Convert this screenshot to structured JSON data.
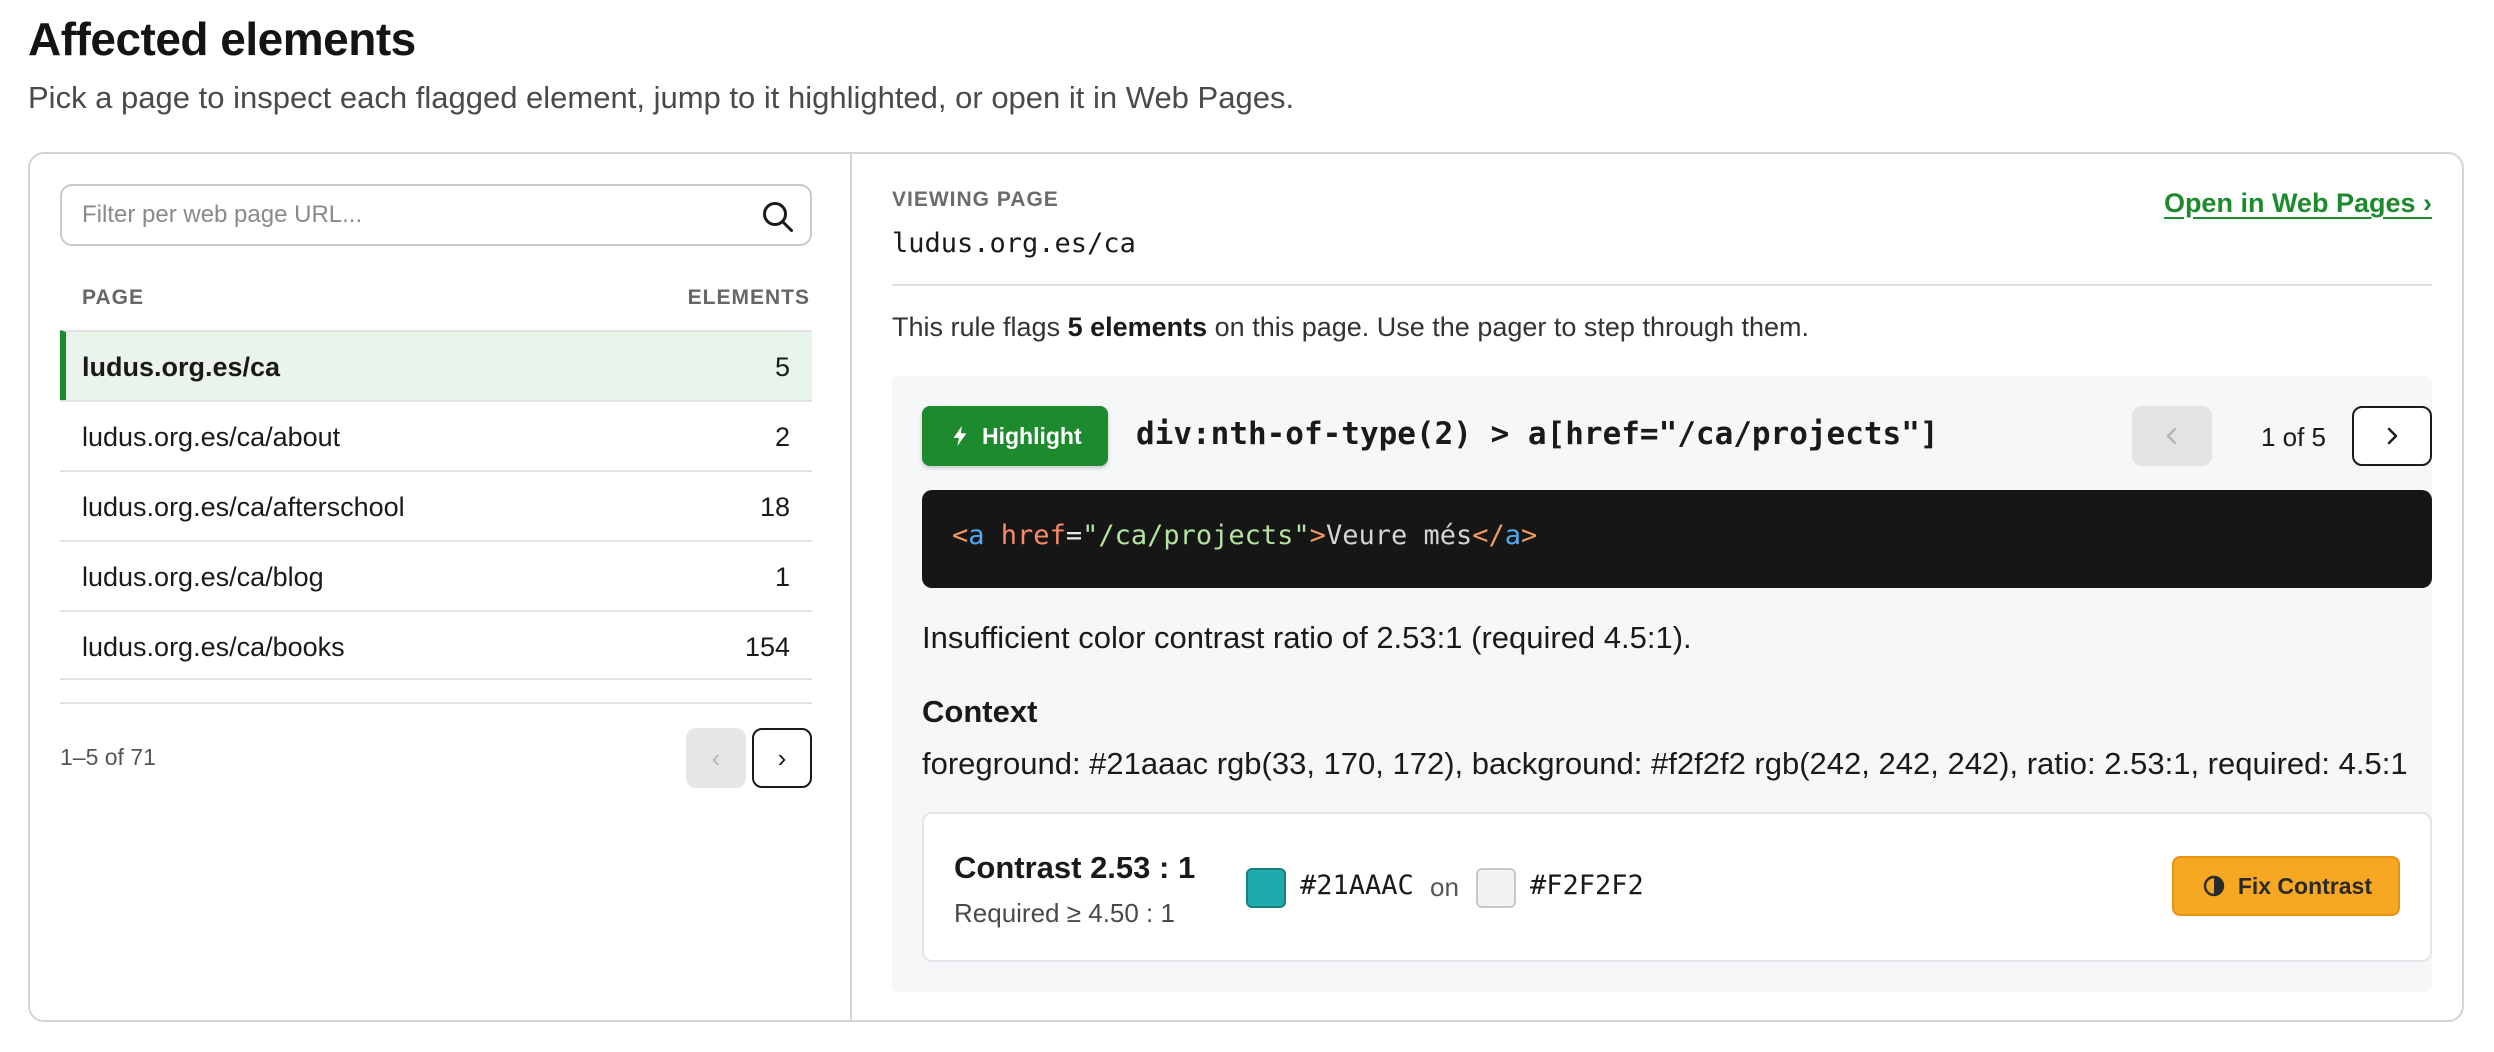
{
  "header": {
    "title": "Affected elements",
    "subtitle": "Pick a page to inspect each flagged element, jump to it highlighted, or open it in Web Pages."
  },
  "filter": {
    "placeholder": "Filter per web page URL...",
    "value": ""
  },
  "table": {
    "col_page": "PAGE",
    "col_elements": "ELEMENTS",
    "rows": [
      {
        "url": "ludus.org.es/ca",
        "count": "5",
        "selected": true
      },
      {
        "url": "ludus.org.es/ca/about",
        "count": "2",
        "selected": false
      },
      {
        "url": "ludus.org.es/ca/afterschool",
        "count": "18",
        "selected": false
      },
      {
        "url": "ludus.org.es/ca/blog",
        "count": "1",
        "selected": false
      },
      {
        "url": "ludus.org.es/ca/books",
        "count": "154",
        "selected": false
      }
    ],
    "range": "1–5 of 71",
    "prev": "‹",
    "next": "›"
  },
  "viewing": {
    "label": "VIEWING PAGE",
    "url": "ludus.org.es/ca",
    "open_link": "Open in Web Pages ›",
    "summary_pre": "This rule flags ",
    "summary_bold": "5 elements",
    "summary_post": " on this page. Use the pager to step through them."
  },
  "element": {
    "highlight_label": "Highlight",
    "selector": "div:nth-of-type(2) > a[href=\"/ca/projects\"]",
    "pager_text": "1 of 5",
    "code": {
      "open_lt": "<",
      "tag": "a",
      "attr": "href",
      "eq": "=",
      "value": "\"/ca/projects\"",
      "gt": ">",
      "text": "Veure més",
      "close_lt": "</",
      "close_tag": "a",
      "close_gt": ">"
    },
    "issue": "Insufficient color contrast ratio of 2.53:1 (required 4.5:1).",
    "context_title": "Context",
    "context_text": "foreground: #21aaac rgb(33, 170, 172), background: #f2f2f2 rgb(242, 242, 242), ratio: 2.53:1, required: 4.5:1"
  },
  "contrast": {
    "title": "Contrast 2.53 : 1",
    "required": "Required ≥ 4.50 : 1",
    "fg_hex": "#21AAAC",
    "on": "on",
    "bg_hex": "#F2F2F2",
    "fix_label": "Fix Contrast"
  },
  "colors": {
    "accent_green": "#1e8a2e",
    "selected_row_bg": "#e9f5ea",
    "fix_button": "#f7a823",
    "foreground_swatch": "#21aaac",
    "background_swatch": "#f2f2f2",
    "code_bg": "#161616"
  },
  "icons": {
    "search": "search-icon",
    "highlight": "bolt-icon",
    "fix": "contrast-icon",
    "pager_prev": "chevron-left-icon",
    "pager_next": "chevron-right-icon"
  }
}
